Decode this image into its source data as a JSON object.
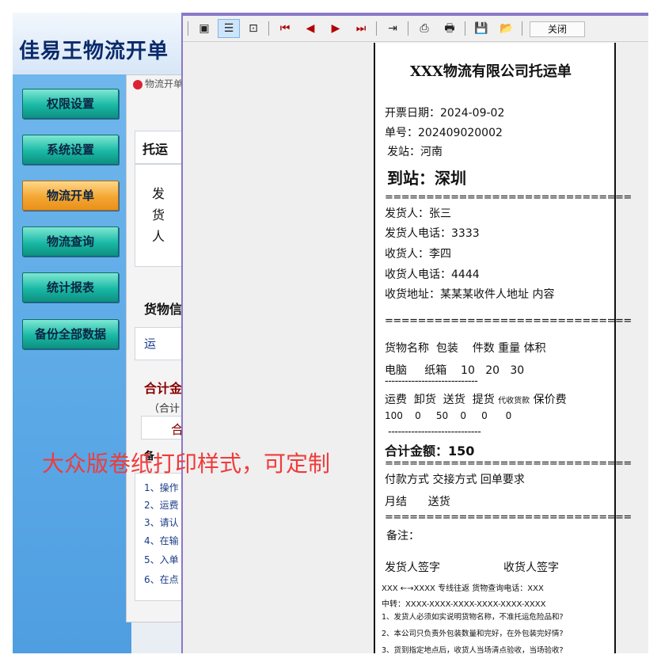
{
  "app": {
    "title": "佳易王物流开单",
    "inner_tab": "物流开单",
    "sidebar": [
      {
        "label": "权限设置",
        "active": false
      },
      {
        "label": "系统设置",
        "active": false
      },
      {
        "label": "物流开单",
        "active": true
      },
      {
        "label": "物流查询",
        "active": false
      },
      {
        "label": "统计报表",
        "active": false
      },
      {
        "label": "备份全部数据",
        "active": false
      }
    ],
    "bg_fragments": {
      "tab": "托运",
      "shipper1": "发",
      "shipper2": "货",
      "shipper3": "人",
      "goods_info": "货物信",
      "transport": "运",
      "total": "合计金",
      "total_sub": "（合计",
      "total_box": "合",
      "note": "备",
      "items": [
        "1、操作",
        "2、运费",
        "3、请认",
        "4、在输",
        "5、入单",
        "6、在点"
      ]
    }
  },
  "watermark": "大众版卷纸打印样式，可定制",
  "preview": {
    "toolbar": {
      "close_label": "关闭",
      "icons": [
        "single-page-icon",
        "page-width-icon",
        "fit-page-icon",
        "first-page-icon",
        "prev-page-icon",
        "next-page-icon",
        "last-page-icon",
        "goto-page-icon",
        "print-setup-icon",
        "print-icon",
        "save-icon",
        "open-icon"
      ]
    },
    "receipt": {
      "title": "XXX物流有限公司托运单",
      "date": "开票日期：2024-09-02",
      "order_no": "单号：202409020002",
      "from": "发站：河南",
      "to": "到站：深圳",
      "sep": "==============================",
      "sender": "发货人：张三",
      "sender_phone": "发货人电话：3333",
      "receiver": "收货人：李四",
      "receiver_phone": "收货人电话：4444",
      "address": "收货地址：某某某收件人地址 内容",
      "goods_header": "货物名称  包装    件数 重量 体积",
      "goods_row": "电脑     纸箱    10   20   30",
      "dash_sep": "----------------------------",
      "fee_header_a": "运费  卸货  送货  提货",
      "fee_header_b": "代收货款",
      "fee_header_c": "保价费",
      "fee_row": "100    0     50    0     0      0",
      "total": "合计金额：150",
      "pay_header": "付款方式  交接方式  回单要求",
      "pay_row": "月结      送货",
      "remark": "备注：",
      "sign_sender": "发货人签字",
      "sign_receiver": "收货人签字",
      "route": "XXX ←→XXXX 专线往返 货物查询电话：XXX",
      "transfer": "中转：XXXX-XXXX-XXXX-XXXX-XXXX-XXXX",
      "term1": "1、发货人必须如实说明货物名称，不准托运危险品和?",
      "term2": "2、本公司只负责外包装数量和完好，在外包装完好情?",
      "term3": "3、货到指定地点后，收货人当场清点验收，当场验收?"
    }
  }
}
